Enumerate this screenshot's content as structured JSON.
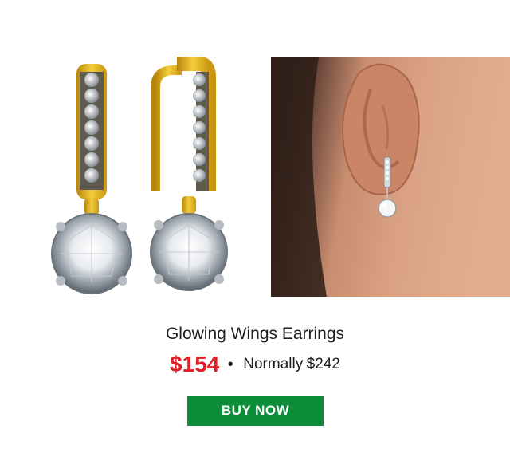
{
  "product": {
    "name": "Glowing Wings Earrings",
    "sale_price": "$154",
    "separator": "•",
    "normally_label": "Normally",
    "original_price": "$242"
  },
  "cta": {
    "label": "BUY NOW"
  },
  "images": {
    "left_icon": "earrings-product-photo",
    "right_icon": "ear-model-photo"
  },
  "colors": {
    "sale_price": "#e31e24",
    "button_bg": "#0d8c3a",
    "gold": "#e5b417"
  }
}
